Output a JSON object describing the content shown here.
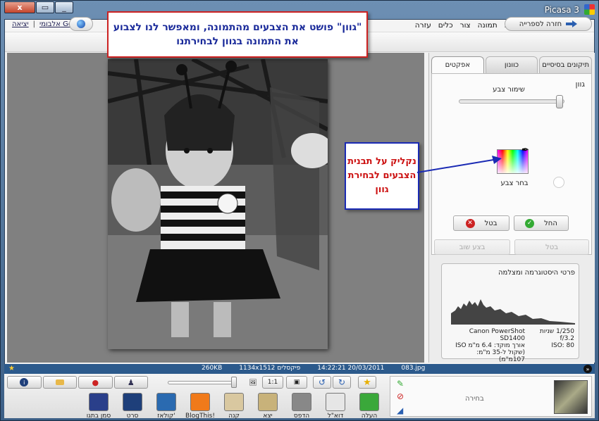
{
  "window": {
    "title": "Picasa 3",
    "close": "x",
    "restore": "▭",
    "minimize": "_"
  },
  "menu": [
    "קובץ",
    "ערוך",
    "הצג",
    "אלבום",
    "תמונה",
    "צור",
    "כלים",
    "עזרה"
  ],
  "account": {
    "signout": "יציאה",
    "email_label": "אלבומי Google",
    "mid": "|"
  },
  "toolbar": {
    "back_label": "חזרה לספרייה"
  },
  "tabs": [
    {
      "label": "תיקונים בסיסיים",
      "active": false
    },
    {
      "label": "כוונון",
      "active": false
    },
    {
      "label": "אפקטים",
      "active": true
    }
  ],
  "effect": {
    "title": "גוון",
    "keep_label": "שימור צבע",
    "keep_value": 0.95,
    "pick_label": "בחר צבע",
    "apply_label": "החל",
    "cancel_label": "בטל",
    "undo_label": "בטל",
    "redo_label": "בצע שוב"
  },
  "histogram": {
    "title": "פרטי היסטוגרמה ומצלמה",
    "camera_lines": [
      "Canon PowerShot SD1400",
      "אורך מוקד: 6.4 מ\"מ ISO",
      "(שקול ל-35 מ\"מ: 107מ\"מ)"
    ],
    "exposure_lines": [
      "1/250 שניות",
      "f/3.2",
      "ISO: 80"
    ]
  },
  "status": {
    "filename": "083.jpg",
    "datetime": "14:22:21 20/03/2011",
    "dimensions": "1134x1512 פיקסלים",
    "size": "260KB"
  },
  "actions": [
    {
      "label": "העלה",
      "color": "#3aa83a"
    },
    {
      "label": "דוא\"ל",
      "color": "#e6e6e6"
    },
    {
      "label": "הדפס",
      "color": "#888888"
    },
    {
      "label": "יצא",
      "color": "#c8b27a"
    },
    {
      "label": "קנה",
      "color": "#d9c8a0"
    },
    {
      "label": "BlogThis!",
      "color": "#f07a1a"
    },
    {
      "label": "קולאז'",
      "color": "#2a6ab0"
    },
    {
      "label": "סרט",
      "color": "#1e3f7a"
    },
    {
      "label": "סמן בתגו",
      "color": "#2a3f8a"
    }
  ],
  "tray": {
    "label": "בחירה"
  },
  "annotations": {
    "callout1": "\"גוון\" פושט את הצבעים מהתמונה, ומאפשר לנו לצבוע את התמונה בגוון לבחירתנו",
    "callout2": "נקליק על תבנית הצבעים לבחירת גוון"
  }
}
